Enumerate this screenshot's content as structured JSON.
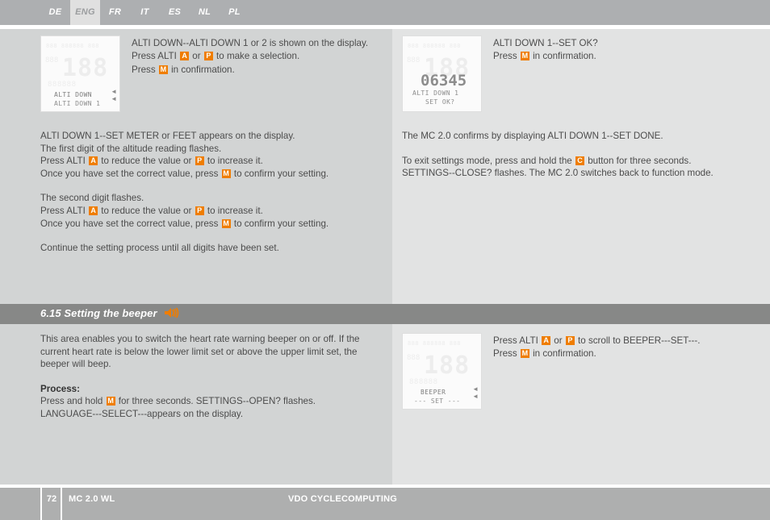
{
  "language_tabs": [
    {
      "label": "DE",
      "active": false
    },
    {
      "label": "ENG",
      "active": true
    },
    {
      "label": "FR",
      "active": false
    },
    {
      "label": "IT",
      "active": false
    },
    {
      "label": "ES",
      "active": false
    },
    {
      "label": "NL",
      "active": false
    },
    {
      "label": "PL",
      "active": false
    }
  ],
  "keys": {
    "alti_a": "A",
    "p": "P",
    "m": "M",
    "c": "C"
  },
  "top_left": {
    "lcd": {
      "seg_top": "888 888888 888",
      "seg_left": "888",
      "seg_big": "188",
      "seg_mid": "888888",
      "label1": "ALTI DOWN",
      "label2": "ALTI DOWN 1"
    },
    "line1_a": "ALTI DOWN--ALTI DOWN 1 or 2 is shown on the display.",
    "line2_a": "Press ALTI ",
    "line2_b": " or ",
    "line2_c": " to make a selection.",
    "line3_a": "Press ",
    "line3_b": " in confirmation."
  },
  "top_left_body": {
    "p1_l1": "ALTI DOWN 1--SET METER or FEET appears on the display.",
    "p1_l2": "The first digit of the altitude reading flashes.",
    "p1_l3_a": "Press ALTI ",
    "p1_l3_b": " to reduce the value or ",
    "p1_l3_c": " to increase it.",
    "p1_l4_a": "Once you have set the correct value, press ",
    "p1_l4_b": " to confirm your setting.",
    "p2_l1": "The second digit flashes.",
    "p2_l2_a": "Press ALTI ",
    "p2_l2_b": " to reduce the value or ",
    "p2_l2_c": " to increase it.",
    "p2_l3_a": "Once you have set the correct value, press ",
    "p2_l3_b": " to confirm your setting.",
    "p3_l1": "Continue the setting process until all digits have been set."
  },
  "top_right": {
    "lcd": {
      "seg_top": "888 888888 888",
      "seg_left": "888",
      "seg_big": "188",
      "value": "06345",
      "label1": "ALTI DOWN 1",
      "label2": "SET OK?"
    },
    "line1": "ALTI DOWN 1--SET OK?",
    "line2_a": "Press ",
    "line2_b": " in confirmation.",
    "p1": "The MC 2.0 confirms by displaying ALTI DOWN 1--SET DONE.",
    "p2_l1_a": "To exit settings mode, press and hold the ",
    "p2_l1_b": " button for three seconds.",
    "p2_l2": "SETTINGS--CLOSE? flashes. The MC 2.0 switches back to function mode."
  },
  "section": {
    "number": "6.15",
    "title": "6.15 Setting the beeper",
    "icon": "beeper-sound-icon",
    "icon_color": "#ef7d00"
  },
  "beeper_left": {
    "intro": "This area enables you to switch the heart rate warning beeper on or off. If the current heart rate is below the lower limit set or above the upper limit set, the beeper will beep.",
    "process_label": "Process:",
    "process_l1_a": "Press and hold ",
    "process_l1_b": " for three seconds. SETTINGS--OPEN? flashes.",
    "process_l2": "LANGUAGE---SELECT---appears on the display."
  },
  "beeper_right": {
    "lcd": {
      "seg_top": "888 888888 888",
      "seg_left": "888",
      "seg_big": "188",
      "seg_mid": "888888",
      "label1": "BEEPER",
      "label2": "--- SET ---"
    },
    "line1_a": "Press ALTI ",
    "line1_b": " or ",
    "line1_c": " to scroll to BEEPER---SET---.",
    "line2_a": "Press ",
    "line2_b": " in confirmation."
  },
  "footer": {
    "page_number": "72",
    "model": "MC 2.0 WL",
    "brand": "VDO CYCLECOMPUTING"
  },
  "colors": {
    "accent_orange": "#ef7d00",
    "bar_gray": "#878887",
    "tabbar_gray": "#adafb1",
    "col_left_bg": "#d2d4d4",
    "col_right_bg": "#e2e3e3",
    "footer_gray": "#aeafaf"
  }
}
